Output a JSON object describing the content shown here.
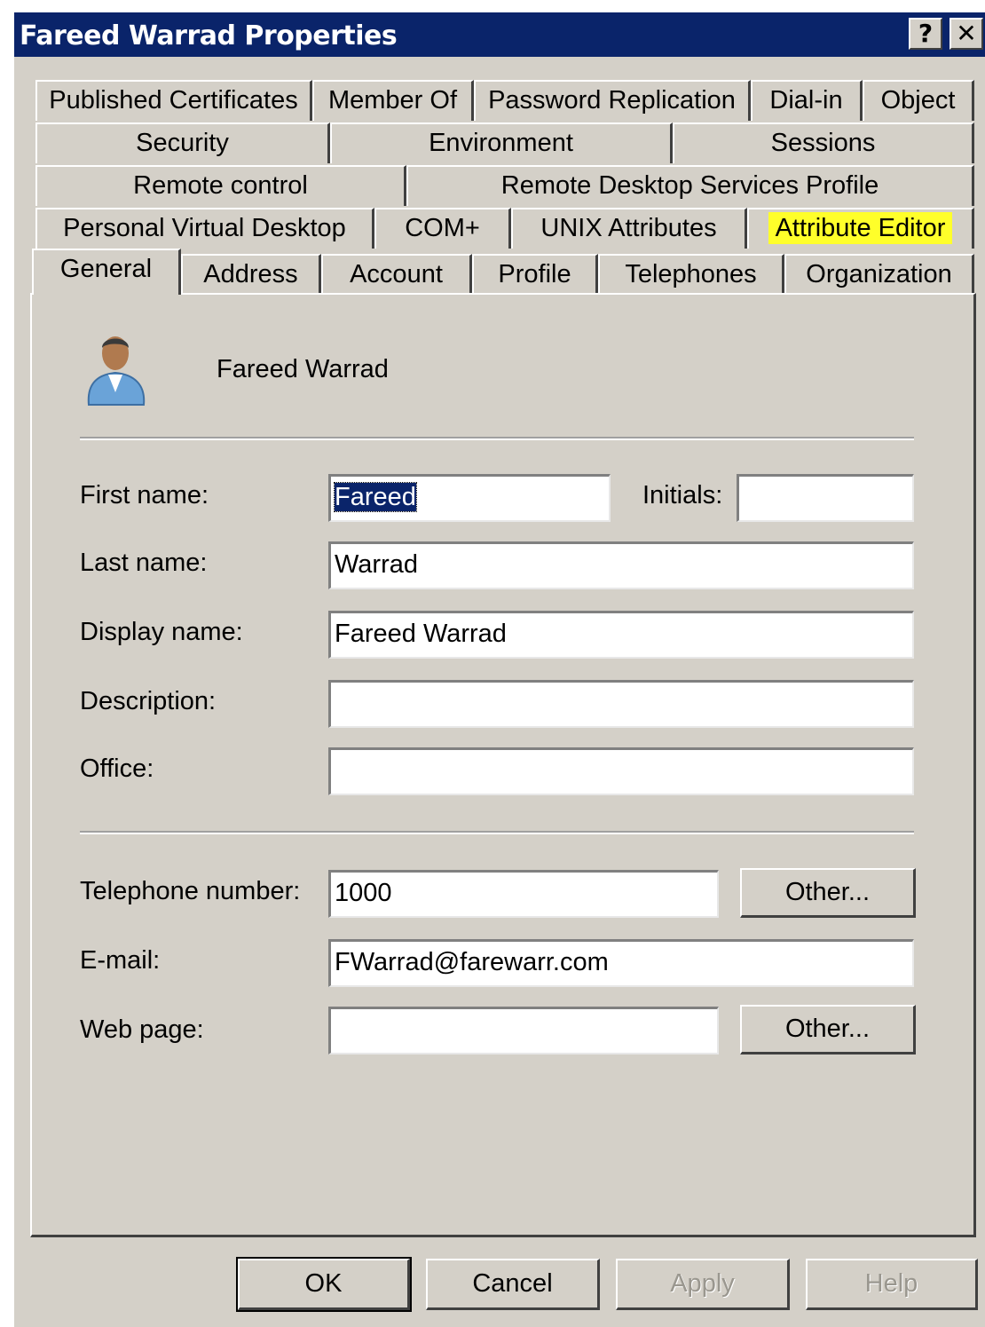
{
  "window": {
    "title": "Fareed Warrad Properties",
    "help_glyph": "?",
    "close_glyph": "✕"
  },
  "tabs": {
    "row1": [
      "Published Certificates",
      "Member Of",
      "Password Replication",
      "Dial-in",
      "Object"
    ],
    "row2": [
      "Security",
      "Environment",
      "Sessions"
    ],
    "row3": [
      "Remote control",
      "Remote Desktop Services Profile"
    ],
    "row4": [
      "Personal Virtual Desktop",
      "COM+",
      "UNIX Attributes",
      "Attribute Editor"
    ],
    "row5": [
      "General",
      "Address",
      "Account",
      "Profile",
      "Telephones",
      "Organization"
    ],
    "active": "General",
    "highlighted": "Attribute Editor",
    "highlight_color": "#ffff2a"
  },
  "general": {
    "user_icon": "user-avatar-icon",
    "display_heading": "Fareed Warrad",
    "first_name_label": "First name:",
    "first_name_value": "Fareed",
    "initials_label": "Initials:",
    "initials_value": "",
    "last_name_label": "Last name:",
    "last_name_value": "Warrad",
    "display_name_label": "Display name:",
    "display_name_value": "Fareed Warrad",
    "description_label": "Description:",
    "description_value": "",
    "office_label": "Office:",
    "office_value": "",
    "telephone_label": "Telephone number:",
    "telephone_value": "1000",
    "telephone_other": "Other...",
    "email_label": "E-mail:",
    "email_value": "FWarrad@farewarr.com",
    "webpage_label": "Web page:",
    "webpage_value": "",
    "webpage_other": "Other..."
  },
  "buttons": {
    "ok": "OK",
    "cancel": "Cancel",
    "apply": "Apply",
    "help": "Help"
  },
  "colors": {
    "titlebar": "#0a246a",
    "face": "#d4d0c8",
    "selection": "#0a246a"
  }
}
